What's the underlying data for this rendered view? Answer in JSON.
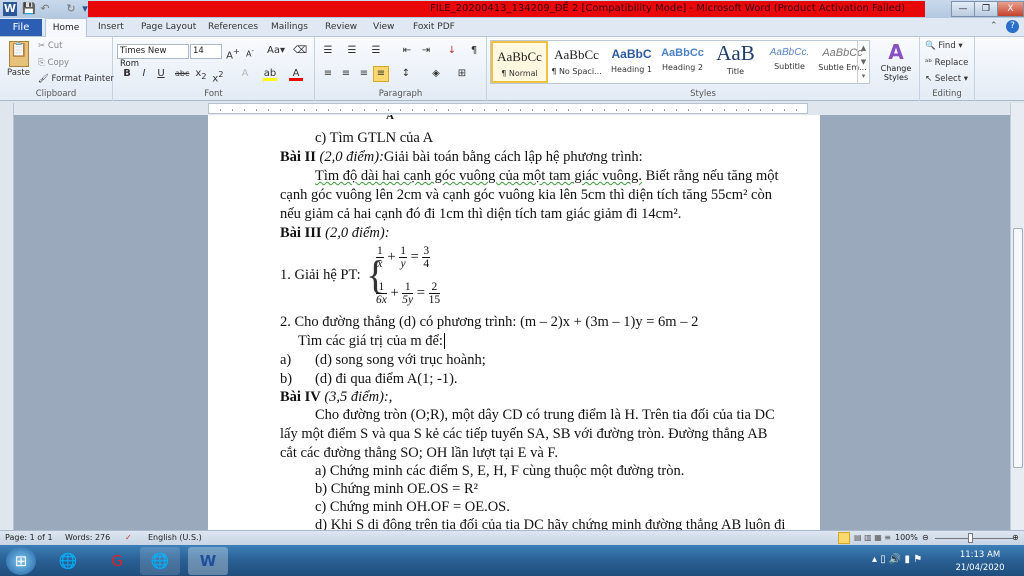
{
  "window": {
    "title": "FILE_20200413_134209_ĐỀ 2 [Compatibility Mode]  -  Microsoft Word (Product Activation Failed)",
    "minimize": "—",
    "restore": "❐",
    "close": "X"
  },
  "tabs": [
    "File",
    "Home",
    "Insert",
    "Page Layout",
    "References",
    "Mailings",
    "Review",
    "View",
    "Foxit PDF"
  ],
  "clipboard": {
    "paste": "Paste",
    "cut": "Cut",
    "copy": "Copy",
    "format_painter": "Format Painter",
    "label": "Clipboard"
  },
  "font": {
    "name": "Times New Rom",
    "size": "14",
    "label": "Font"
  },
  "paragraph": {
    "label": "Paragraph"
  },
  "styles": {
    "items": [
      {
        "preview": "AaBbCc",
        "name": "¶ Normal"
      },
      {
        "preview": "AaBbCc",
        "name": "¶ No Spaci..."
      },
      {
        "preview": "AaBbC",
        "name": "Heading 1"
      },
      {
        "preview": "AaBbCc",
        "name": "Heading 2"
      },
      {
        "preview": "AaB",
        "name": "Title"
      },
      {
        "preview": "AaBbCc.",
        "name": "Subtitle"
      },
      {
        "preview": "AaBbCc",
        "name": "Subtle Em..."
      }
    ],
    "change": "Change Styles",
    "label": "Styles"
  },
  "editing": {
    "find": "Find",
    "replace": "Replace",
    "select": "Select",
    "label": "Editing"
  },
  "doc": {
    "l0": "A",
    "l1": "c) Tìm GTLN của A",
    "l2b": "Bài II",
    "l2i": "(2,0 điểm):",
    "l2": "Giải bài toán bằng cách lập hệ phương trình:",
    "l3a": "Tìm độ dài hai cạnh góc vuông của một tam giác vuông.",
    "l3b": " Biết rằng nếu tăng một",
    "l4": "cạnh góc vuông lên 2cm và cạnh góc vuông kia lên 5cm thì diện tích tăng 55cm² còn",
    "l5": "nếu giảm cả hai cạnh đó đi 1cm thì diện tích tam giác giảm đi 14cm².",
    "l6b": "Bài III",
    "l6i": "(2,0 điểm):",
    "l7": "1. Giải hệ PT:",
    "eq1": [
      "1",
      "x",
      "1",
      "y",
      "3",
      "4"
    ],
    "eq2": [
      "1",
      "6x",
      "1",
      "5y",
      "2",
      "15"
    ],
    "l8": "2. Cho đường thẳng (d) có phương trình: (m – 2)x + (3m – 1)y = 6m – 2",
    "l9": "Tìm các giá trị của m để:",
    "l10m": "a)",
    "l10": "(d) song song với trục hoành;",
    "l11m": "b)",
    "l11": "(d) đi qua điểm A(1; -1).",
    "l12b": "Bài IV",
    "l12i": "(3,5 điểm):,",
    "l13": "Cho đường tròn (O;R), một dây CD có trung điểm là H. Trên tia đối của tia DC",
    "l14": "lấy một điểm S và qua S kẻ các tiếp tuyến SA, SB với đường tròn. Đường thẳng AB",
    "l15": "cắt các đường thẳng SO; OH lần lượt tại E và F.",
    "l16": "a) Chứng minh các điểm S, E, H, F cùng thuộc một đường tròn.",
    "l17": "b) Chứng minh OE.OS = R²",
    "l18": "c) Chứng minh OH.OF = OE.OS.",
    "l19": "d) Khi S di động trên tia đối của tia DC hãy chứng minh đường thẳng AB luôn đi"
  },
  "status": {
    "page": "Page: 1 of 1",
    "words": "Words: 276",
    "lang": "English (U.S.)",
    "zoom": "100%"
  },
  "clock": {
    "time": "11:13 AM",
    "date": "21/04/2020"
  }
}
